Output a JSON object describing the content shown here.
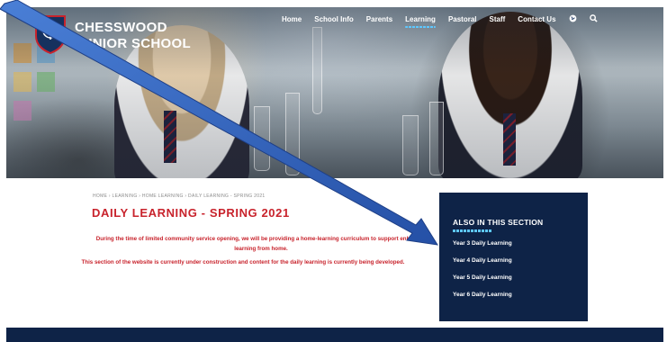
{
  "header": {
    "school_name_line1": "CHESSWOOD",
    "school_name_line2": "JUNIOR SCHOOL"
  },
  "nav": {
    "items": [
      "Home",
      "School Info",
      "Parents",
      "Learning",
      "Pastoral",
      "Staff",
      "Contact Us"
    ],
    "active": "Learning",
    "icons": [
      "globe-icon",
      "search-icon"
    ]
  },
  "main": {
    "breadcrumb": "HOME › LEARNING › HOME LEARNING › DAILY LEARNING - SPRING 2021",
    "title": "DAILY LEARNING - SPRING 2021",
    "intro": "During the time of limited community service opening, we will be providing a home-learning curriculum to support enhanced learning from home.",
    "note": "This section of the website is currently under construction and content for the daily learning is currently being developed."
  },
  "sidebar": {
    "heading": "ALSO IN THIS SECTION",
    "links": [
      "Year 3 Daily Learning",
      "Year 4 Daily Learning",
      "Year 5 Daily Learning",
      "Year 6 Daily Learning"
    ]
  },
  "colors": {
    "navy": "#0e2347",
    "accent_red": "#c8232c",
    "arrow_blue": "#2e5fb8",
    "underline_cyan": "#5ec8ff"
  }
}
